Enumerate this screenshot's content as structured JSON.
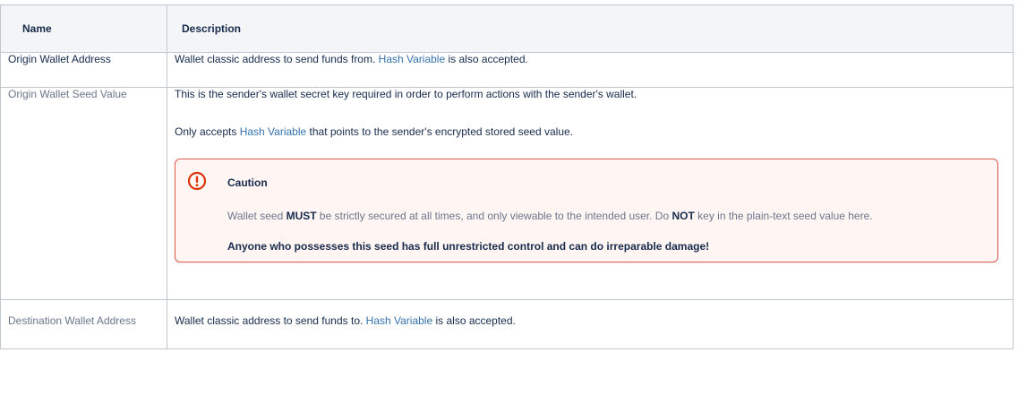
{
  "table": {
    "headers": {
      "name": "Name",
      "description": "Description"
    },
    "rows": [
      {
        "name": "Origin Wallet Address",
        "desc_before": "Wallet classic address to send funds from. ",
        "link": "Hash Variable",
        "desc_after": " is also accepted."
      },
      {
        "name": "Origin Wallet Seed Value",
        "para1": "This is the sender's wallet secret key required in order to perform actions with the sender's wallet.",
        "para2_before": "Only accepts ",
        "link": "Hash Variable",
        "para2_after": " that points to the sender's encrypted stored seed value.",
        "caution": {
          "title": "Caution",
          "body_part1": "Wallet seed ",
          "must": "MUST",
          "body_part2": " be strictly secured at all times, and only viewable to the intended user. Do ",
          "not": "NOT",
          "body_part3": " key in the plain-text seed value here.",
          "warning": "Anyone who possesses this seed has full unrestricted control and can do irreparable damage!",
          "icon": "warning-circle-icon",
          "color": "#de350b"
        }
      },
      {
        "name": "Destination Wallet Address",
        "desc_before": "Wallet classic address to send funds to. ",
        "link": "Hash Variable",
        "desc_after": " is also accepted."
      }
    ]
  },
  "colors": {
    "link": "#3572b0",
    "header_bg": "#f4f5f7",
    "border": "#c1c7d0",
    "caution_border": "#de5a4d",
    "caution_bg": "#fff5f3"
  }
}
